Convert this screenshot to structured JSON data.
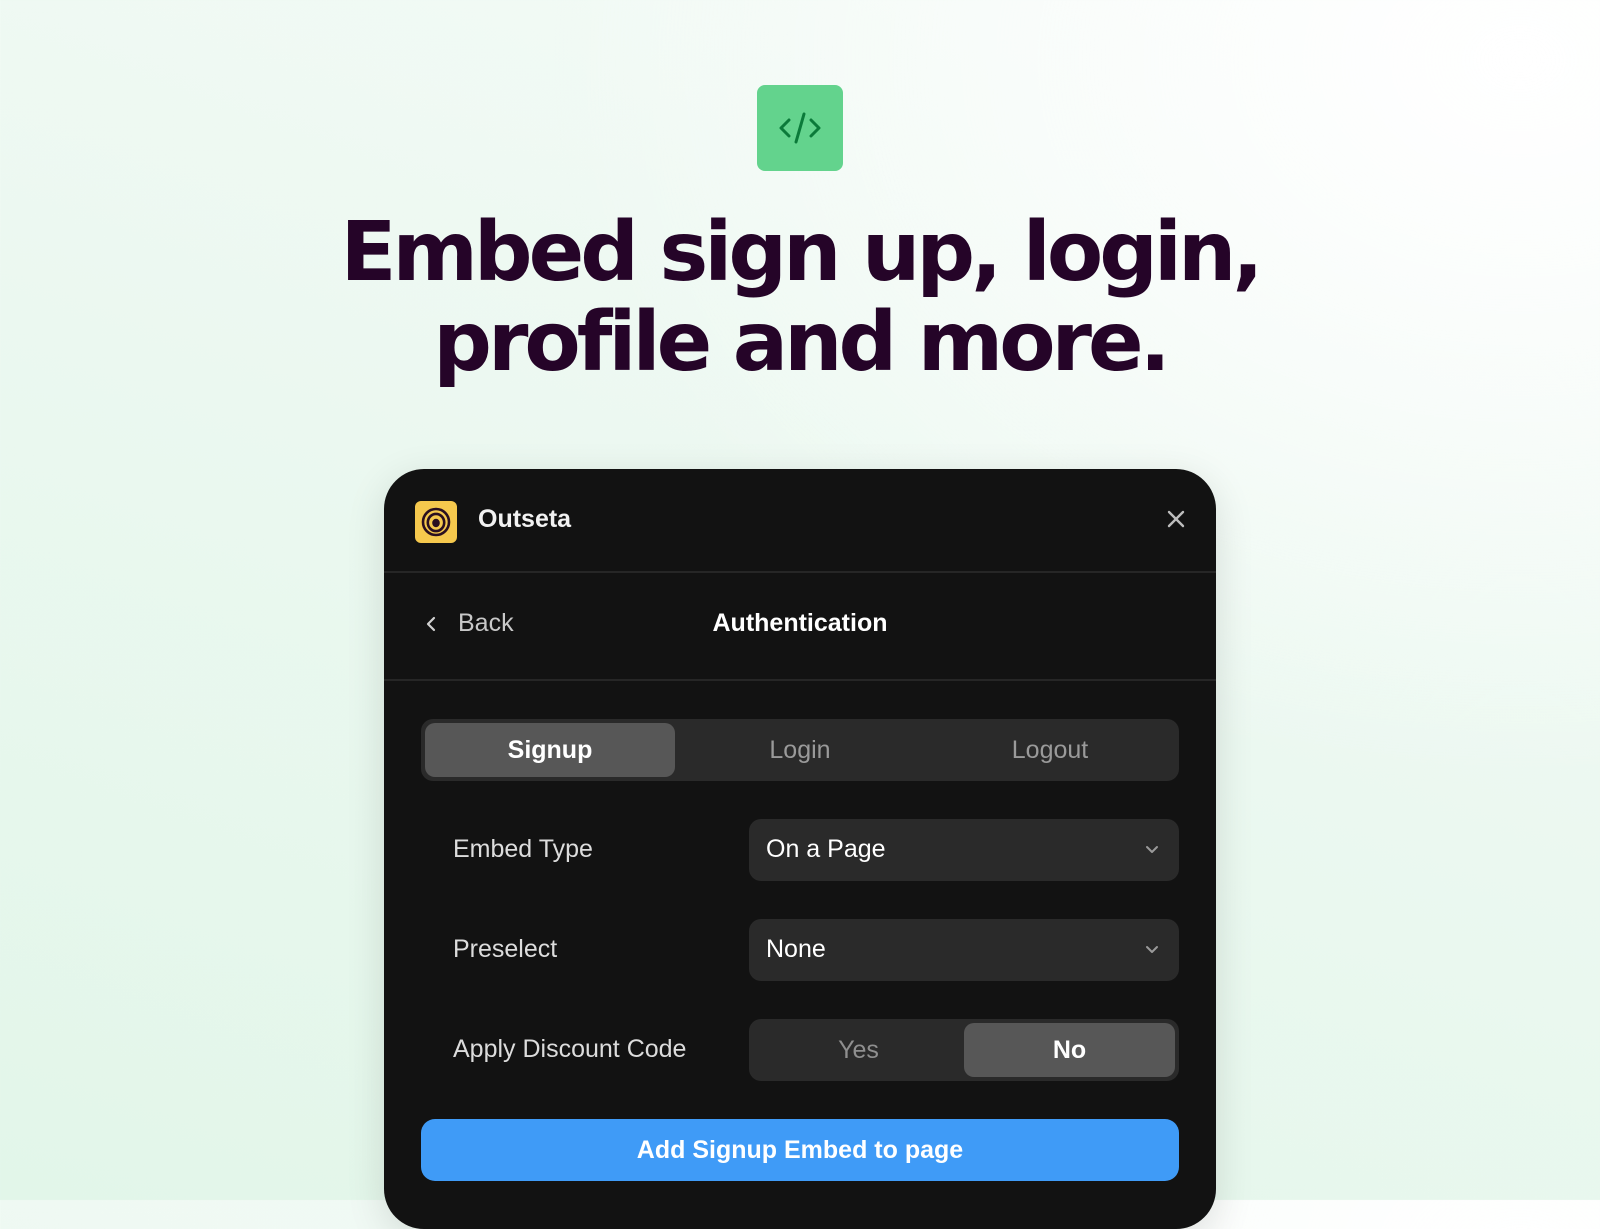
{
  "hero": {
    "icon": "code-icon",
    "headline_line1": "Embed sign up, login,",
    "headline_line2": "profile and more."
  },
  "colors": {
    "badge": "#63d38d",
    "badge_glyph": "#0b7a3a",
    "headline": "#250428",
    "panel": "#121212",
    "logo": "#f5c84d",
    "cta": "#3f9bf7"
  },
  "panel": {
    "brand": "Outseta",
    "close_icon": "close-icon",
    "back_label": "Back",
    "title": "Authentication",
    "tabs": [
      {
        "label": "Signup",
        "active": true
      },
      {
        "label": "Login",
        "active": false
      },
      {
        "label": "Logout",
        "active": false
      }
    ],
    "fields": {
      "embed_type": {
        "label": "Embed Type",
        "value": "On a Page"
      },
      "preselect": {
        "label": "Preselect",
        "value": "None"
      },
      "discount": {
        "label": "Apply Discount Code",
        "options": [
          {
            "label": "Yes",
            "active": false
          },
          {
            "label": "No",
            "active": true
          }
        ]
      }
    },
    "cta_label": "Add Signup Embed to page"
  }
}
